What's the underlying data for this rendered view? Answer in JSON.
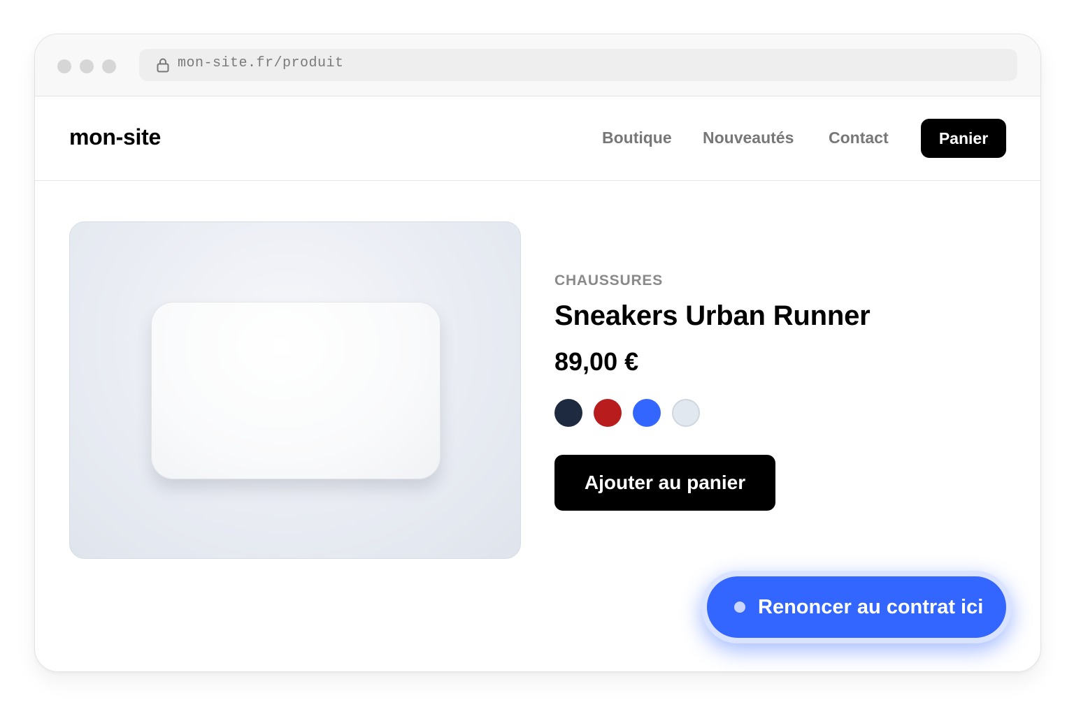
{
  "browser": {
    "url": "mon-site.fr/produit",
    "icons": {
      "lock": "lock-icon"
    }
  },
  "header": {
    "logo": "mon-site",
    "nav": [
      {
        "label": "Boutique"
      },
      {
        "label": "Nouveautés"
      },
      {
        "label": "Contact"
      }
    ],
    "cart_label": "Panier"
  },
  "product": {
    "category": "CHAUSSURES",
    "title": "Sneakers Urban Runner",
    "price": "89,00 €",
    "colors": [
      {
        "name": "navy",
        "hex": "#1e2a40"
      },
      {
        "name": "red",
        "hex": "#b91c1c"
      },
      {
        "name": "blue",
        "hex": "#3366ff"
      },
      {
        "name": "light-grey",
        "hex": "#e2e8f0"
      }
    ],
    "add_to_cart_label": "Ajouter au panier"
  },
  "withdrawal": {
    "label": "Renoncer au contrat ici",
    "color": "#3366ff"
  }
}
